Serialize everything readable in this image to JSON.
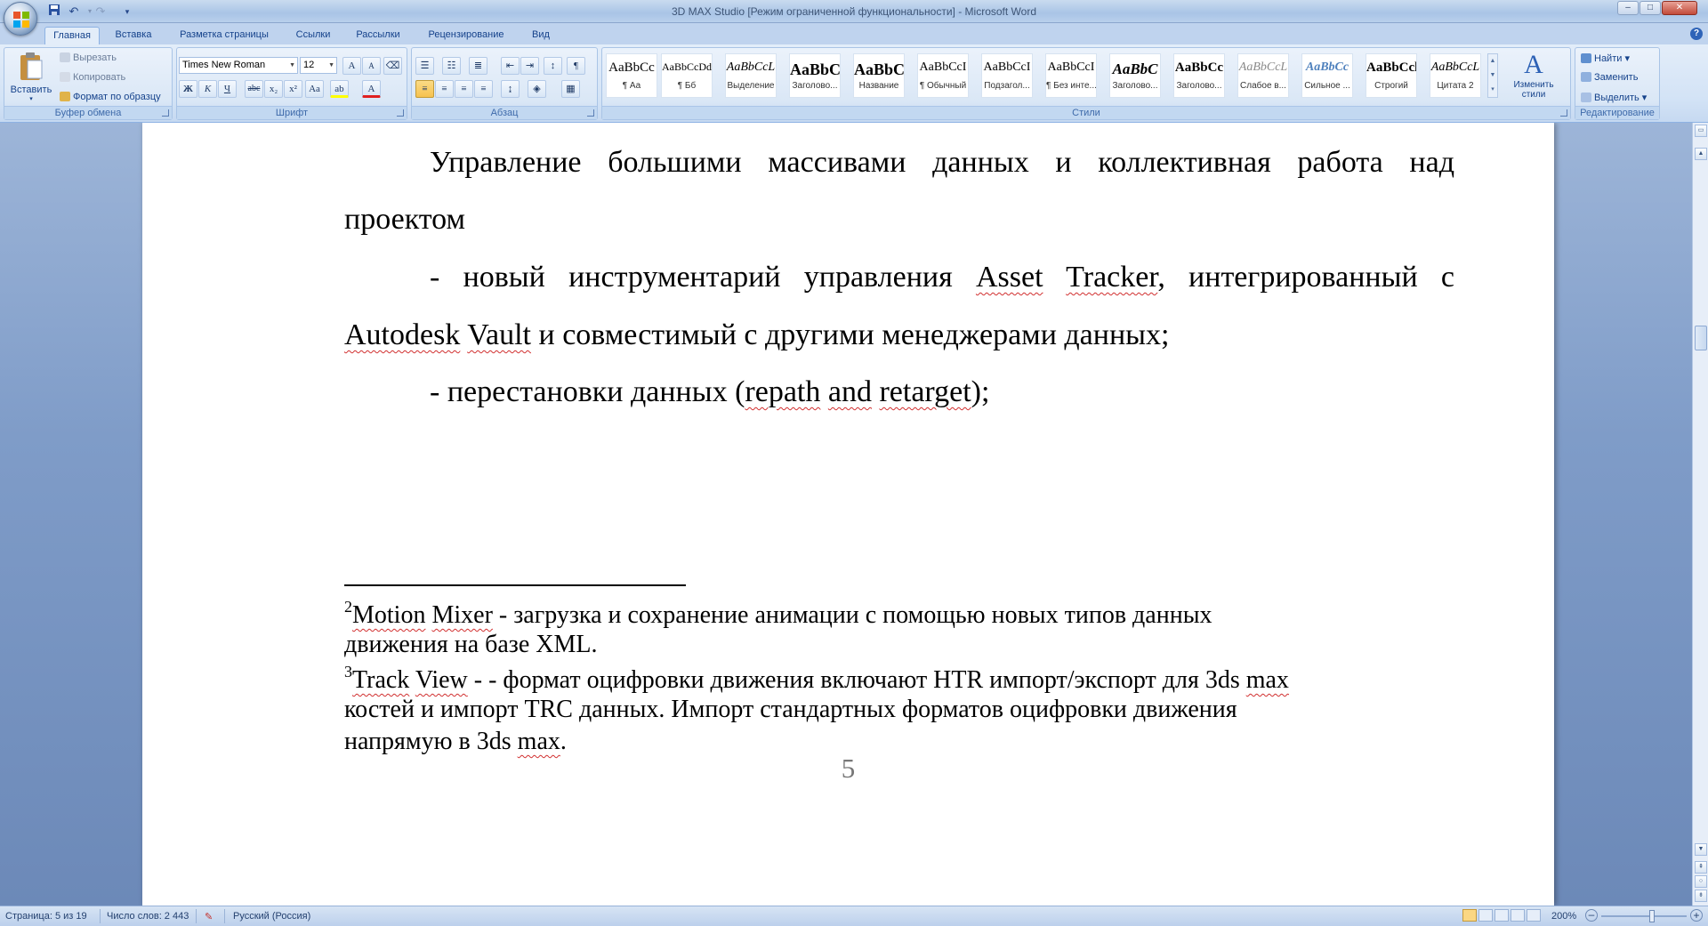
{
  "window": {
    "title": "3D MAX Studio [Режим ограниченной функциональности] - Microsoft Word",
    "minimize": "–",
    "restore": "□",
    "close": "✕"
  },
  "tabs": [
    "Главная",
    "Вставка",
    "Разметка страницы",
    "Ссылки",
    "Рассылки",
    "Рецензирование",
    "Вид"
  ],
  "active_tab": "Главная",
  "ribbon": {
    "clipboard": {
      "label": "Буфер обмена",
      "paste": "Вставить",
      "cut": "Вырезать",
      "copy": "Копировать",
      "format_painter": "Формат по образцу"
    },
    "font": {
      "label": "Шрифт",
      "font_name": "Times New Roman",
      "font_size": "12",
      "grow": "A",
      "shrink": "A",
      "bold": "Ж",
      "italic": "К",
      "underline": "Ч",
      "strike": "abc",
      "subscript": "x₂",
      "superscript": "x²",
      "change_case": "Aa",
      "highlight": "ab",
      "font_color": "A"
    },
    "paragraph": {
      "label": "Абзац",
      "show_marks": "¶"
    },
    "styles": {
      "label": "Стили",
      "items": [
        {
          "sample": "AaBbCc",
          "name": "¶ Аа"
        },
        {
          "sample": "AaBbCcDd",
          "name": "¶ Бб"
        },
        {
          "sample": "AaBbCcL",
          "name": "Выделение"
        },
        {
          "sample": "AaBbC",
          "name": "Заголово..."
        },
        {
          "sample": "AaBbC",
          "name": "Название"
        },
        {
          "sample": "AaBbCcI",
          "name": "¶ Обычный"
        },
        {
          "sample": "AaBbCcI",
          "name": "Подзагол..."
        },
        {
          "sample": "AaBbCcI",
          "name": "¶ Без инте..."
        },
        {
          "sample": "AaBbC",
          "name": "Заголово..."
        },
        {
          "sample": "AaBbCc",
          "name": "Заголово..."
        },
        {
          "sample": "AaBbCcL",
          "name": "Слабое в..."
        },
        {
          "sample": "AaBbCc",
          "name": "Сильное ..."
        },
        {
          "sample": "AaBbCcl",
          "name": "Строгий"
        },
        {
          "sample": "AaBbCcL",
          "name": "Цитата 2"
        }
      ],
      "change_styles": "Изменить стили"
    },
    "editing": {
      "label": "Редактирование",
      "find": "Найти",
      "replace": "Заменить",
      "select": "Выделить"
    }
  },
  "document": {
    "p1_line1": "Управление большими массивами данных и коллективная работа над",
    "p1_line2": "проектом",
    "p2_line1_a": "- новый инструментарий управления ",
    "p2_line1_b": "Asset",
    "p2_line1_c": " ",
    "p2_line1_d": "Tracker",
    "p2_line1_e": ", интегрированный с",
    "p2_line2_a": "Autodesk",
    "p2_line2_b": " ",
    "p2_line2_c": "Vault",
    "p2_line2_d": " и совместимый с другими менеджерами данных;",
    "p3_a": "- перестановки данных (",
    "p3_b": "repath",
    "p3_c": " ",
    "p3_d": "and",
    "p3_e": " ",
    "p3_f": "retarget",
    "p3_g": ");",
    "fn2_num": "2",
    "fn2_a": "Motion",
    "fn2_b": " ",
    "fn2_c": "Mixer",
    "fn2_d": " - загрузка и сохранение анимации с помощью новых типов данных",
    "fn2_line2": "движения на базе XML.",
    "fn3_num": "3",
    "fn3_a": "Track",
    "fn3_b": " ",
    "fn3_c": "View",
    "fn3_d": " -  - формат оцифровки движения включают HTR импорт/экспорт для 3ds ",
    "fn3_e": "max",
    "fn3_line2": "костей и импорт TRC данных. Импорт стандартных форматов оцифровки движения",
    "fn3_line3_a": "напрямую в 3ds ",
    "fn3_line3_b": "max",
    "fn3_line3_c": ".",
    "page_number": "5"
  },
  "status": {
    "page": "Страница: 5 из 19",
    "words": "Число слов: 2 443",
    "language": "Русский (Россия)",
    "zoom": "200%"
  },
  "colors": {
    "accent": "#15428b",
    "spell_error": "#d12f2f"
  }
}
